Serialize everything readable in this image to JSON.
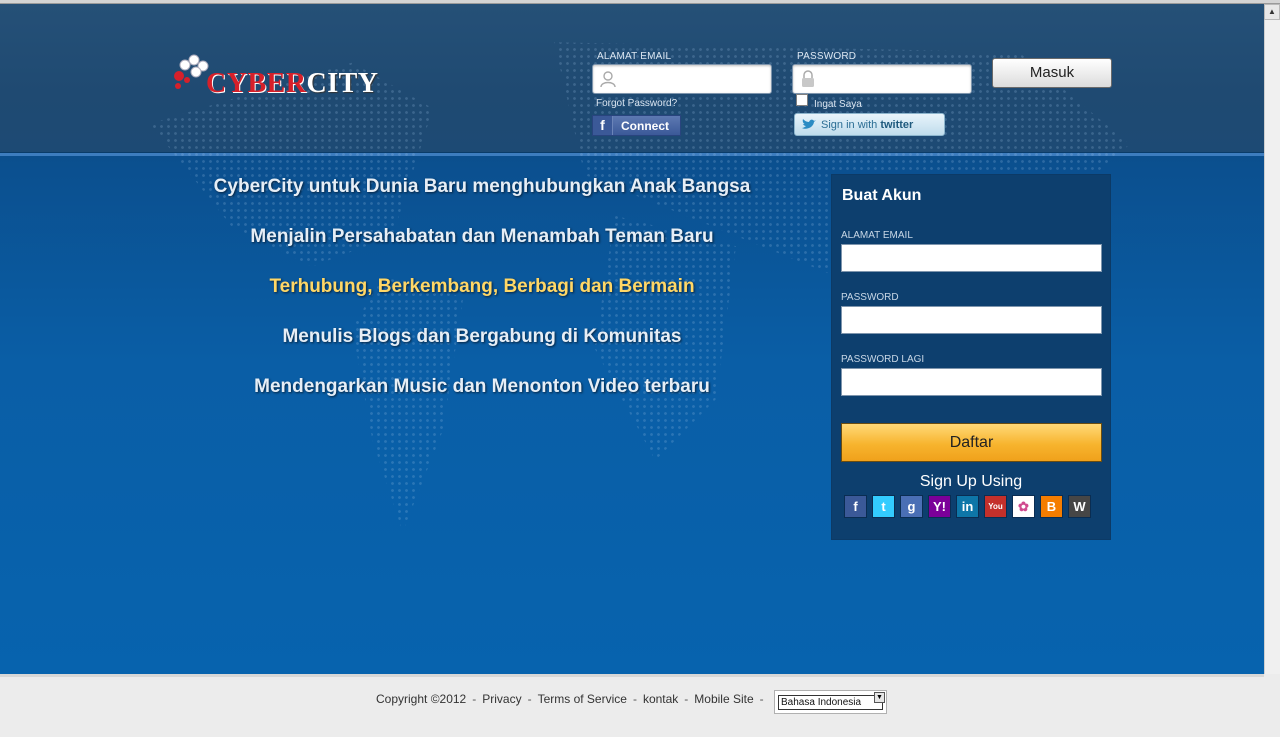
{
  "header": {
    "logo_text_red": "CYBER",
    "logo_text_white": "CITY",
    "email_label": "ALAMAT EMAIL",
    "email_value": "",
    "password_label": "PASSWORD",
    "password_value": "",
    "login_button": "Masuk",
    "forgot_password": "Forgot Password?",
    "remember_me": "Ingat Saya",
    "facebook_connect": "Connect",
    "twitter_signin_prefix": "Sign in with",
    "twitter_signin_brand": "twitter"
  },
  "slogans": [
    {
      "text": "CyberCity untuk Dunia Baru menghubungkan Anak Bangsa",
      "highlight": false
    },
    {
      "text": "Menjalin Persahabatan dan Menambah Teman Baru",
      "highlight": false
    },
    {
      "text": "Terhubung, Berkembang, Berbagi dan Bermain",
      "highlight": true
    },
    {
      "text": "Menulis Blogs dan Bergabung di Komunitas",
      "highlight": false
    },
    {
      "text": "Mendengarkan Music dan Menonton Video terbaru",
      "highlight": false
    }
  ],
  "signup": {
    "title": "Buat Akun",
    "email_label": "ALAMAT EMAIL",
    "email_value": "",
    "password_label": "PASSWORD",
    "password_value": "",
    "password_again_label": "PASSWORD LAGI",
    "password_again_value": "",
    "submit_button": "Daftar",
    "sign_up_using": "Sign Up Using",
    "providers": [
      {
        "name": "facebook",
        "icon": "facebook-icon",
        "glyph": "f",
        "color": "#3b5998"
      },
      {
        "name": "twitter",
        "icon": "twitter-icon",
        "glyph": "t",
        "color": "#33ccff"
      },
      {
        "name": "google",
        "icon": "google-icon",
        "glyph": "g",
        "color": "#4a6fb5"
      },
      {
        "name": "yahoo",
        "icon": "yahoo-icon",
        "glyph": "Y!",
        "color": "#7b0099"
      },
      {
        "name": "linkedin",
        "icon": "linkedin-icon",
        "glyph": "in",
        "color": "#0e76a8"
      },
      {
        "name": "youtube",
        "icon": "youtube-icon",
        "glyph": "You",
        "color": "#c4302b"
      },
      {
        "name": "picasa",
        "icon": "picasa-icon",
        "glyph": "✿",
        "color": "#ffffff"
      },
      {
        "name": "blogger",
        "icon": "blogger-icon",
        "glyph": "B",
        "color": "#f57d00"
      },
      {
        "name": "wordpress",
        "icon": "wordpress-icon",
        "glyph": "W",
        "color": "#464646"
      }
    ]
  },
  "footer": {
    "copyright": "Copyright ©2012",
    "links": [
      "Privacy",
      "Terms of Service",
      "kontak",
      "Mobile Site"
    ],
    "language": "Bahasa Indonesia"
  }
}
